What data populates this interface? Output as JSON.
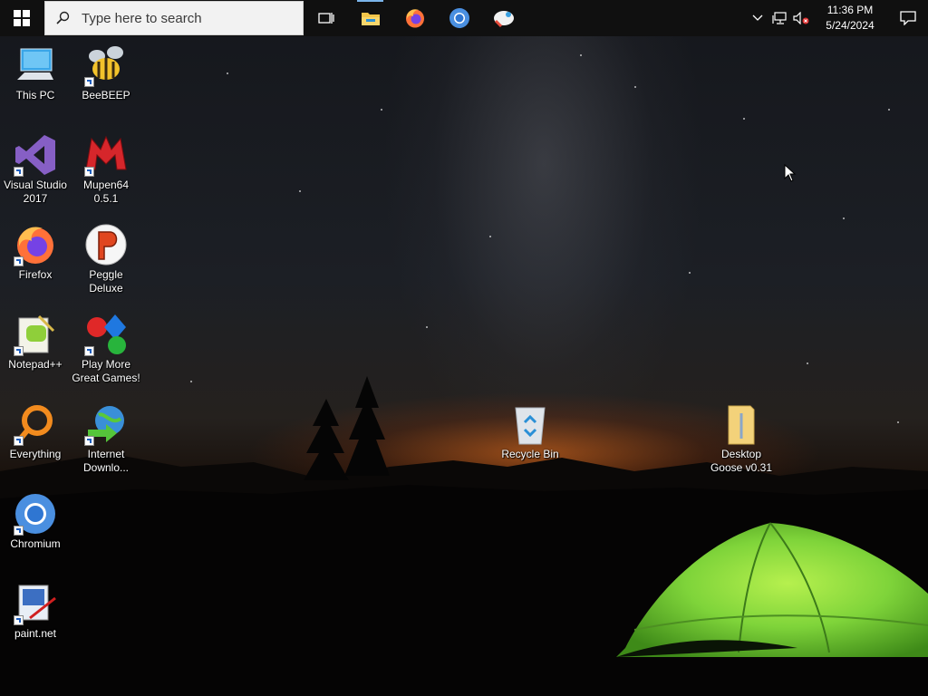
{
  "taskbar": {
    "search_placeholder": "Type here to search",
    "pinned_apps": [
      {
        "name": "task-view",
        "icon": "task-view-icon"
      },
      {
        "name": "file-explorer",
        "icon": "folder-icon",
        "active": true
      },
      {
        "name": "firefox",
        "icon": "firefox-icon"
      },
      {
        "name": "chromium",
        "icon": "chromium-icon"
      },
      {
        "name": "desktop-goose",
        "icon": "goose-icon"
      }
    ],
    "clock": {
      "time": "11:36 PM",
      "date": "5/24/2024"
    }
  },
  "desktop": {
    "icons": [
      {
        "label": "This PC"
      },
      {
        "label": "BeeBEEP"
      },
      {
        "label": "Visual Studio 2017"
      },
      {
        "label": "Mupen64 0.5.1"
      },
      {
        "label": "Firefox"
      },
      {
        "label": "Peggle Deluxe"
      },
      {
        "label": "Notepad++"
      },
      {
        "label": "Play More Great Games!"
      },
      {
        "label": "Everything"
      },
      {
        "label": "Internet Downlo..."
      },
      {
        "label": "Chromium"
      },
      {
        "label": "paint.net"
      },
      {
        "label": "Recycle Bin"
      },
      {
        "label": "Desktop Goose v0.31"
      }
    ]
  },
  "colors": {
    "taskbar_bg": "#101010",
    "accent": "#7ab4ea",
    "tent_green": "#7fd43a"
  }
}
